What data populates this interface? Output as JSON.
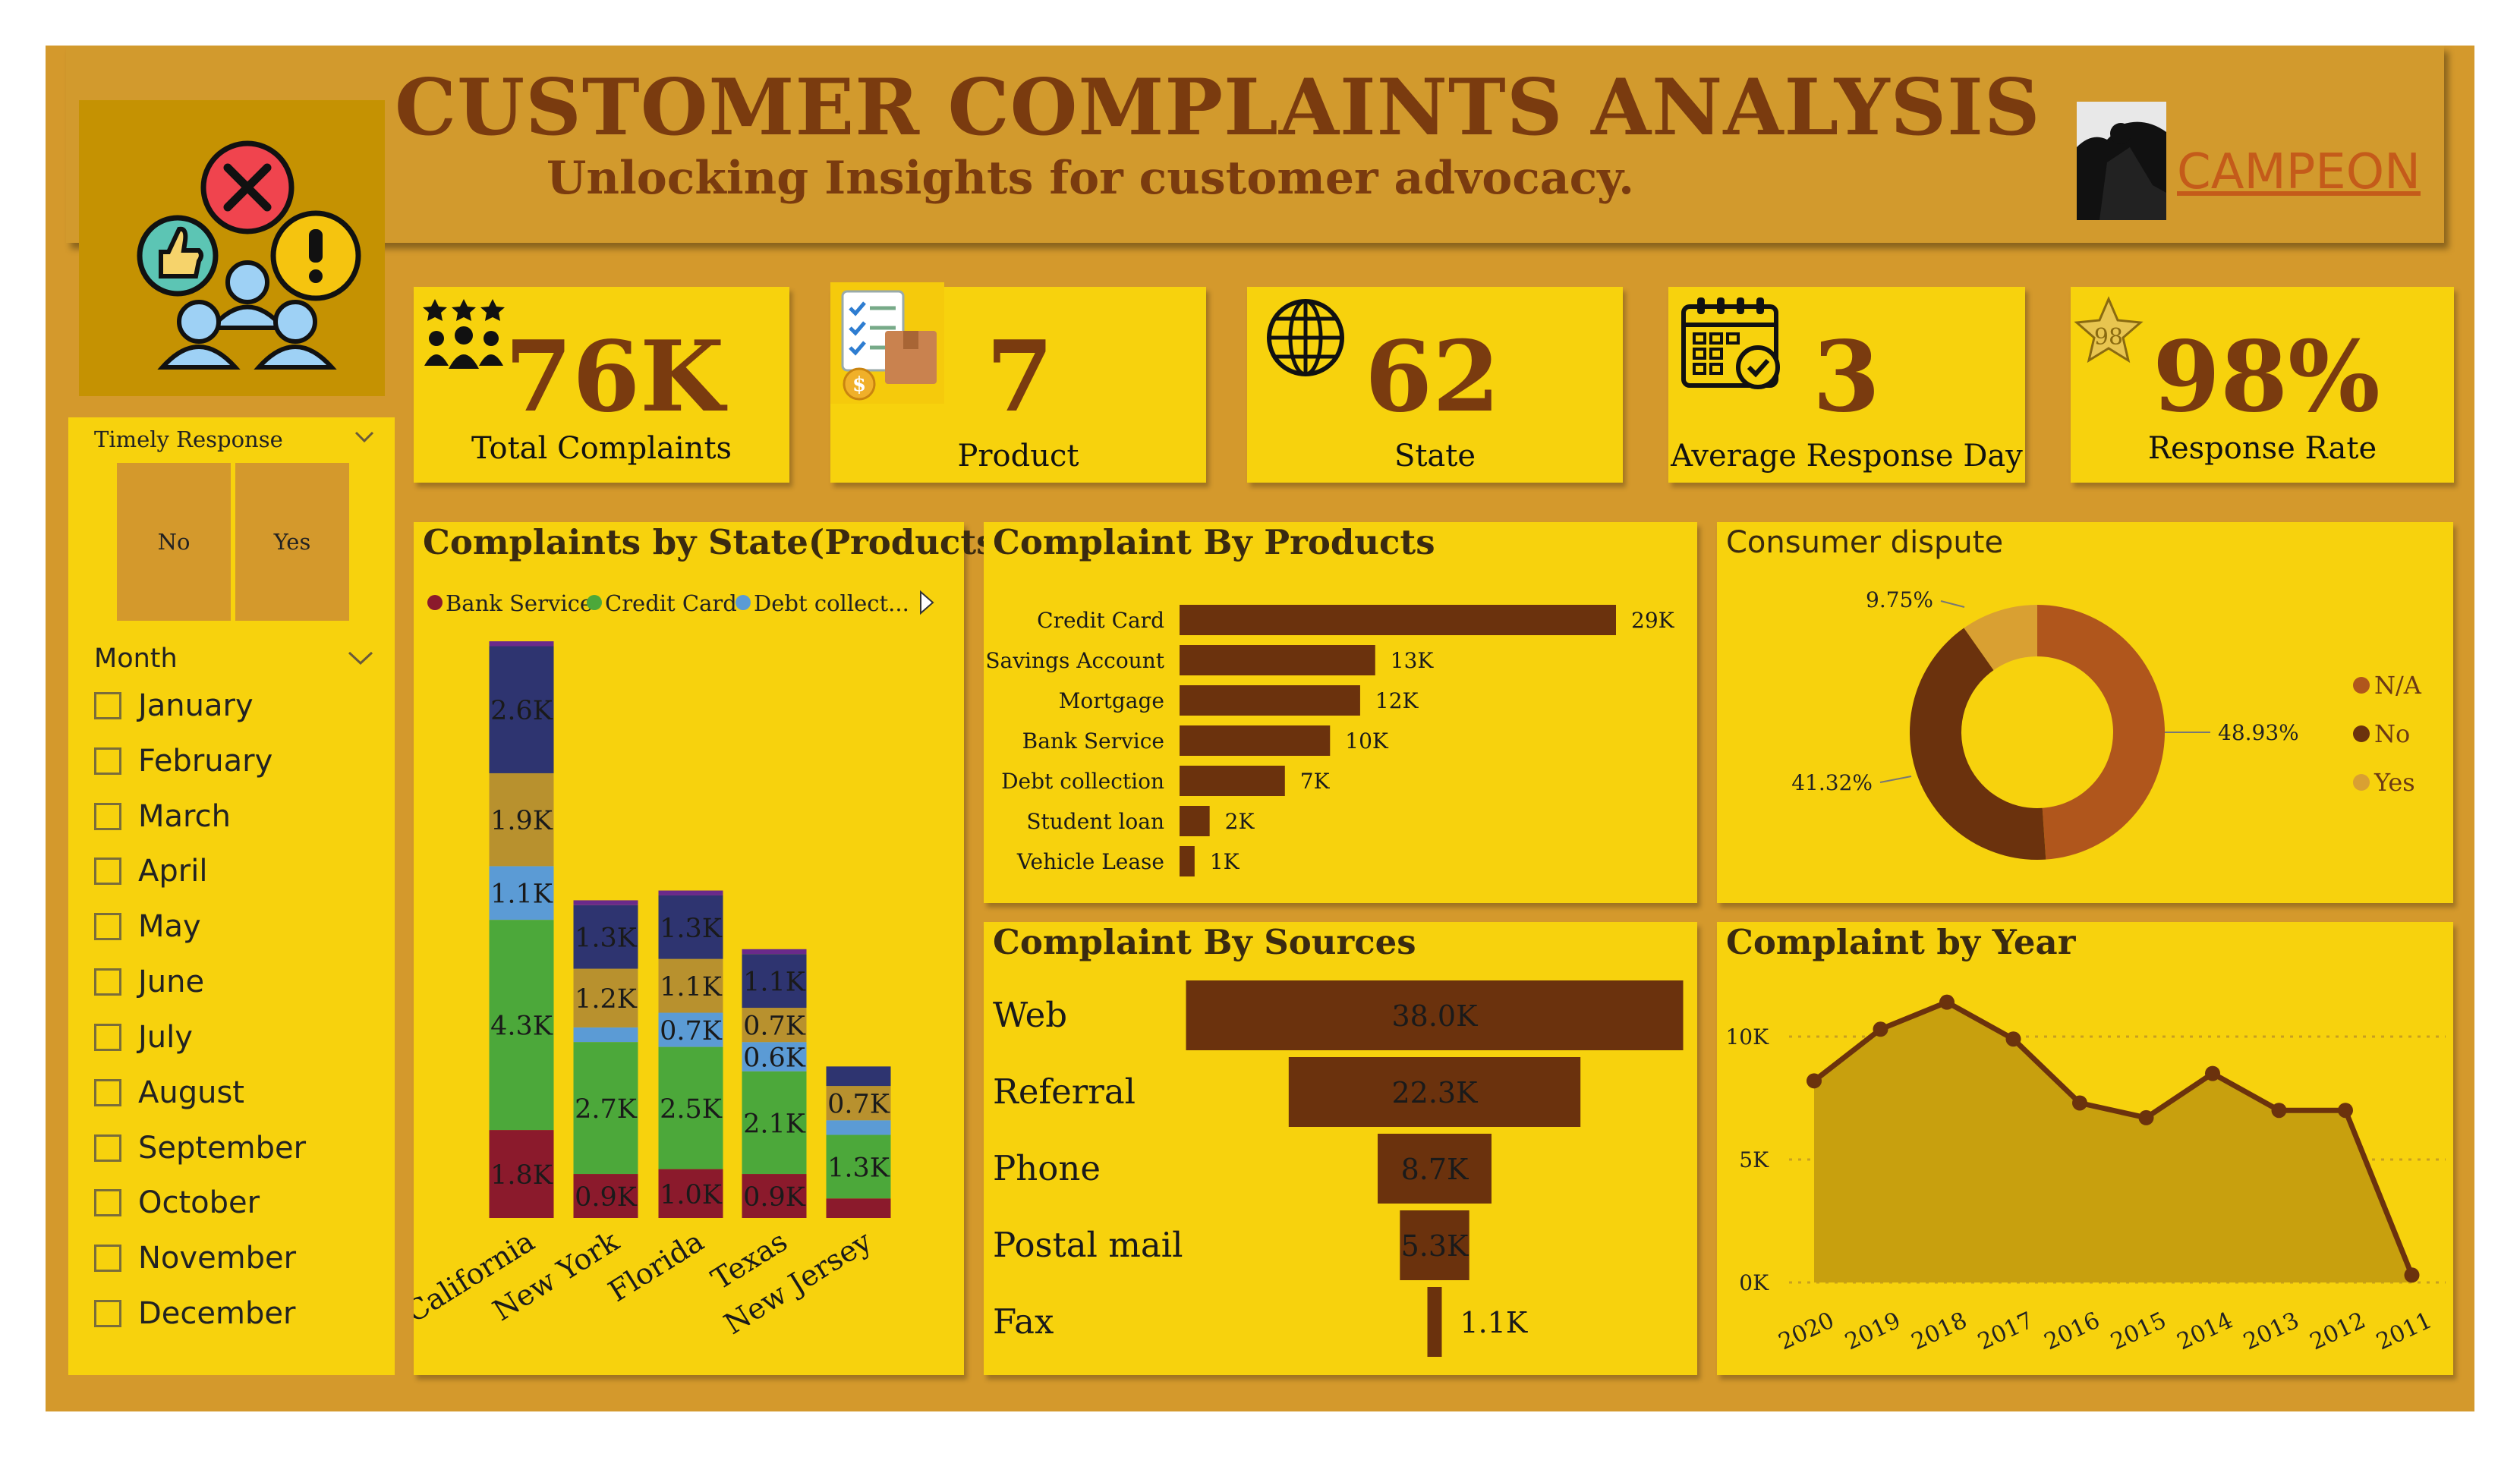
{
  "header": {
    "title": "CUSTOMER COMPLAINTS ANALYSIS",
    "subtitle": "Unlocking Insights for customer advocacy.",
    "brand": "CAMPEON"
  },
  "kpis": [
    {
      "value": "76K",
      "label": "Total Complaints",
      "icon": "people-stars-icon"
    },
    {
      "value": "7",
      "label": "Product",
      "icon": "checklist-box-icon"
    },
    {
      "value": "62",
      "label": "State",
      "icon": "globe-icon"
    },
    {
      "value": "3",
      "label": "Average Response Day",
      "icon": "calendar-check-icon"
    },
    {
      "value": "98%",
      "label": "Response Rate",
      "icon": "star-badge-icon",
      "badge": "98"
    }
  ],
  "filters": {
    "timely_title": "Timely Response",
    "timely_options": [
      "No",
      "Yes"
    ],
    "month_title": "Month",
    "months": [
      "January",
      "February",
      "March",
      "April",
      "May",
      "June",
      "July",
      "August",
      "September",
      "October",
      "November",
      "December"
    ]
  },
  "colors": {
    "dark_brown": "#6B320D",
    "bank_service": "#8B1A2C",
    "credit_card": "#4CA83A",
    "debt_collection": "#5B9BD5",
    "mortgage": "#B8912E",
    "savings": "#2E3470",
    "other": "#6A2A8A",
    "na": "#B0561C",
    "no": "#6B320D",
    "yes": "#D9A032"
  },
  "chart_data": [
    {
      "type": "bar",
      "title": "Complaints by State(Products)",
      "stacked": true,
      "legend": [
        "Bank Service",
        "Credit Card",
        "Debt collect..."
      ],
      "categories": [
        "California",
        "New York",
        "Florida",
        "Texas",
        "New Jersey"
      ],
      "series": [
        {
          "name": "Bank Service",
          "values": [
            1.8,
            0.9,
            1.0,
            0.9,
            0.4
          ],
          "labels": [
            "1.8K",
            "0.9K",
            "1.0K",
            "0.9K",
            ""
          ]
        },
        {
          "name": "Credit Card",
          "values": [
            4.3,
            2.7,
            2.5,
            2.1,
            1.3
          ],
          "labels": [
            "4.3K",
            "2.7K",
            "2.5K",
            "2.1K",
            "1.3K"
          ]
        },
        {
          "name": "Debt collect...",
          "values": [
            1.1,
            0.3,
            0.7,
            0.6,
            0.3
          ],
          "labels": [
            "1.1K",
            "",
            "0.7K",
            "0.6K",
            ""
          ]
        },
        {
          "name": "",
          "values": [
            1.9,
            1.2,
            1.1,
            0.7,
            0.7
          ],
          "labels": [
            "1.9K",
            "1.2K",
            "1.1K",
            "0.7K",
            "0.7K"
          ]
        },
        {
          "name": "",
          "values": [
            2.6,
            1.3,
            1.3,
            1.1,
            0.4
          ],
          "labels": [
            "2.6K",
            "1.3K",
            "1.3K",
            "1.1K",
            ""
          ]
        },
        {
          "name": "",
          "values": [
            0.1,
            0.1,
            0.1,
            0.1,
            0.0
          ],
          "labels": [
            "",
            "",
            "",
            "",
            ""
          ]
        }
      ]
    },
    {
      "type": "bar",
      "orientation": "horizontal",
      "title": "Complaint By Products",
      "categories": [
        "Credit Card",
        "Savings Account",
        "Mortgage",
        "Bank Service",
        "Debt collection",
        "Student loan",
        "Vehicle Lease"
      ],
      "values": [
        29,
        13,
        12,
        10,
        7,
        2,
        1
      ],
      "labels": [
        "29K",
        "13K",
        "12K",
        "10K",
        "7K",
        "2K",
        "1K"
      ]
    },
    {
      "type": "pie",
      "donut": true,
      "title": "Consumer dispute",
      "categories": [
        "N/A",
        "No",
        "Yes"
      ],
      "values": [
        48.93,
        41.32,
        9.75
      ],
      "labels": [
        "48.93%",
        "41.32%",
        "9.75%"
      ],
      "legend_position": "right"
    },
    {
      "type": "bar",
      "orientation": "funnel",
      "title": "Complaint By Sources",
      "categories": [
        "Web",
        "Referral",
        "Phone",
        "Postal mail",
        "Fax"
      ],
      "values": [
        38.0,
        22.3,
        8.7,
        5.3,
        1.1
      ],
      "labels": [
        "38.0K",
        "22.3K",
        "8.7K",
        "5.3K",
        "1.1K"
      ]
    },
    {
      "type": "area",
      "title": "Complaint by Year",
      "x": [
        "2020",
        "2019",
        "2018",
        "2017",
        "2016",
        "2015",
        "2014",
        "2013",
        "2012",
        "2011"
      ],
      "values": [
        8.2,
        10.3,
        11.4,
        9.9,
        7.3,
        6.7,
        8.5,
        7.0,
        7.0,
        0.3
      ],
      "yticks": [
        "0K",
        "5K",
        "10K"
      ],
      "ylim": [
        0,
        12.5
      ],
      "grid": true
    }
  ]
}
